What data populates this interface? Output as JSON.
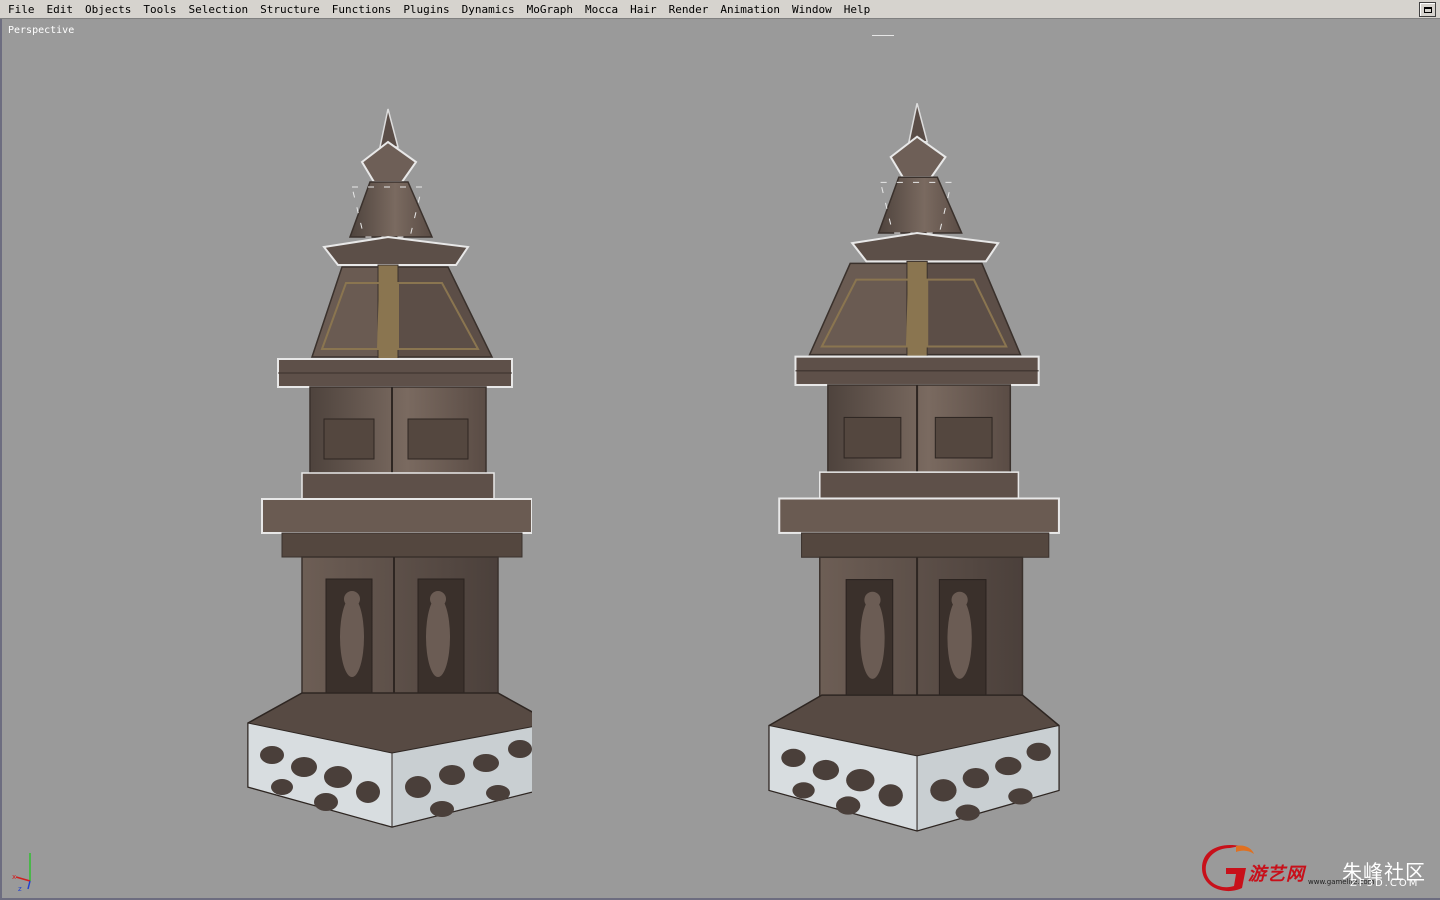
{
  "menubar": {
    "items": [
      "File",
      "Edit",
      "Objects",
      "Tools",
      "Selection",
      "Structure",
      "Functions",
      "Plugins",
      "Dynamics",
      "MoGraph",
      "Mocca",
      "Hair",
      "Render",
      "Animation",
      "Window",
      "Help"
    ]
  },
  "viewport": {
    "label": "Perspective",
    "background": "#9a9a9a"
  },
  "watermark": {
    "brand_cn": "游艺网",
    "community_cn": "朱峰社区",
    "site": "ZF3D.COM",
    "url": "www.gamelife.com"
  },
  "colors": {
    "stone": "#6e6058",
    "stone_dark": "#4a3f3a",
    "snow": "#e6eaec",
    "gold_trim": "#8a7550"
  },
  "icons": [
    "window-restore-icon",
    "axis-gizmo-icon",
    "watermark-logo-icon"
  ]
}
